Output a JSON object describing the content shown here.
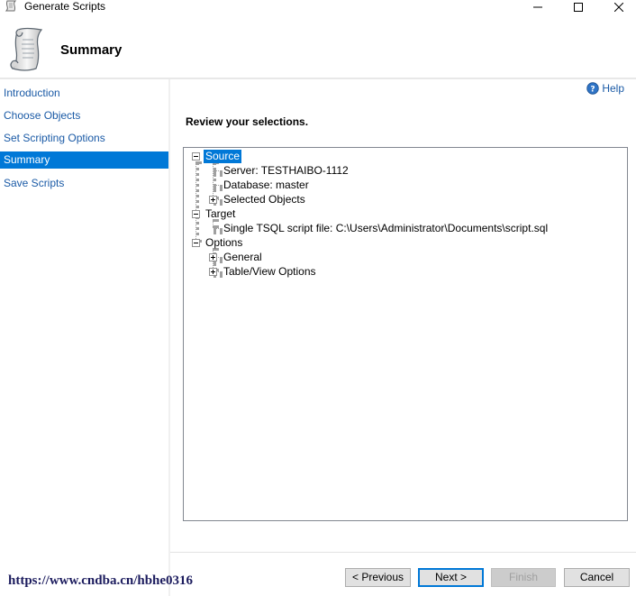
{
  "window": {
    "title": "Generate Scripts",
    "buttons": [
      "minimize-icon",
      "maximize-icon",
      "close-icon"
    ]
  },
  "header": {
    "title": "Summary",
    "icon": "scroll-icon"
  },
  "sidebar": {
    "items": [
      {
        "label": "Introduction",
        "active": false
      },
      {
        "label": "Choose Objects",
        "active": false
      },
      {
        "label": "Set Scripting Options",
        "active": false
      },
      {
        "label": "Summary",
        "active": true
      },
      {
        "label": "Save Scripts",
        "active": false
      }
    ]
  },
  "main": {
    "help_label": "Help",
    "review_heading": "Review your selections."
  },
  "tree": {
    "source": {
      "label": "Source",
      "server": "Server: TESTHAIBO-1112",
      "database": "Database: master",
      "selected_objects": "Selected Objects"
    },
    "target": {
      "label": "Target",
      "file": "Single TSQL script file: C:\\Users\\Administrator\\Documents\\script.sql"
    },
    "options": {
      "label": "Options",
      "general": "General",
      "table_view": "Table/View Options"
    }
  },
  "footer": {
    "previous": "< Previous",
    "next": "Next >",
    "finish": "Finish",
    "cancel": "Cancel",
    "watermark": "https://www.cndba.cn/hbhe0316"
  },
  "colors": {
    "accent": "#0078d7",
    "link": "#1a5aa6"
  }
}
